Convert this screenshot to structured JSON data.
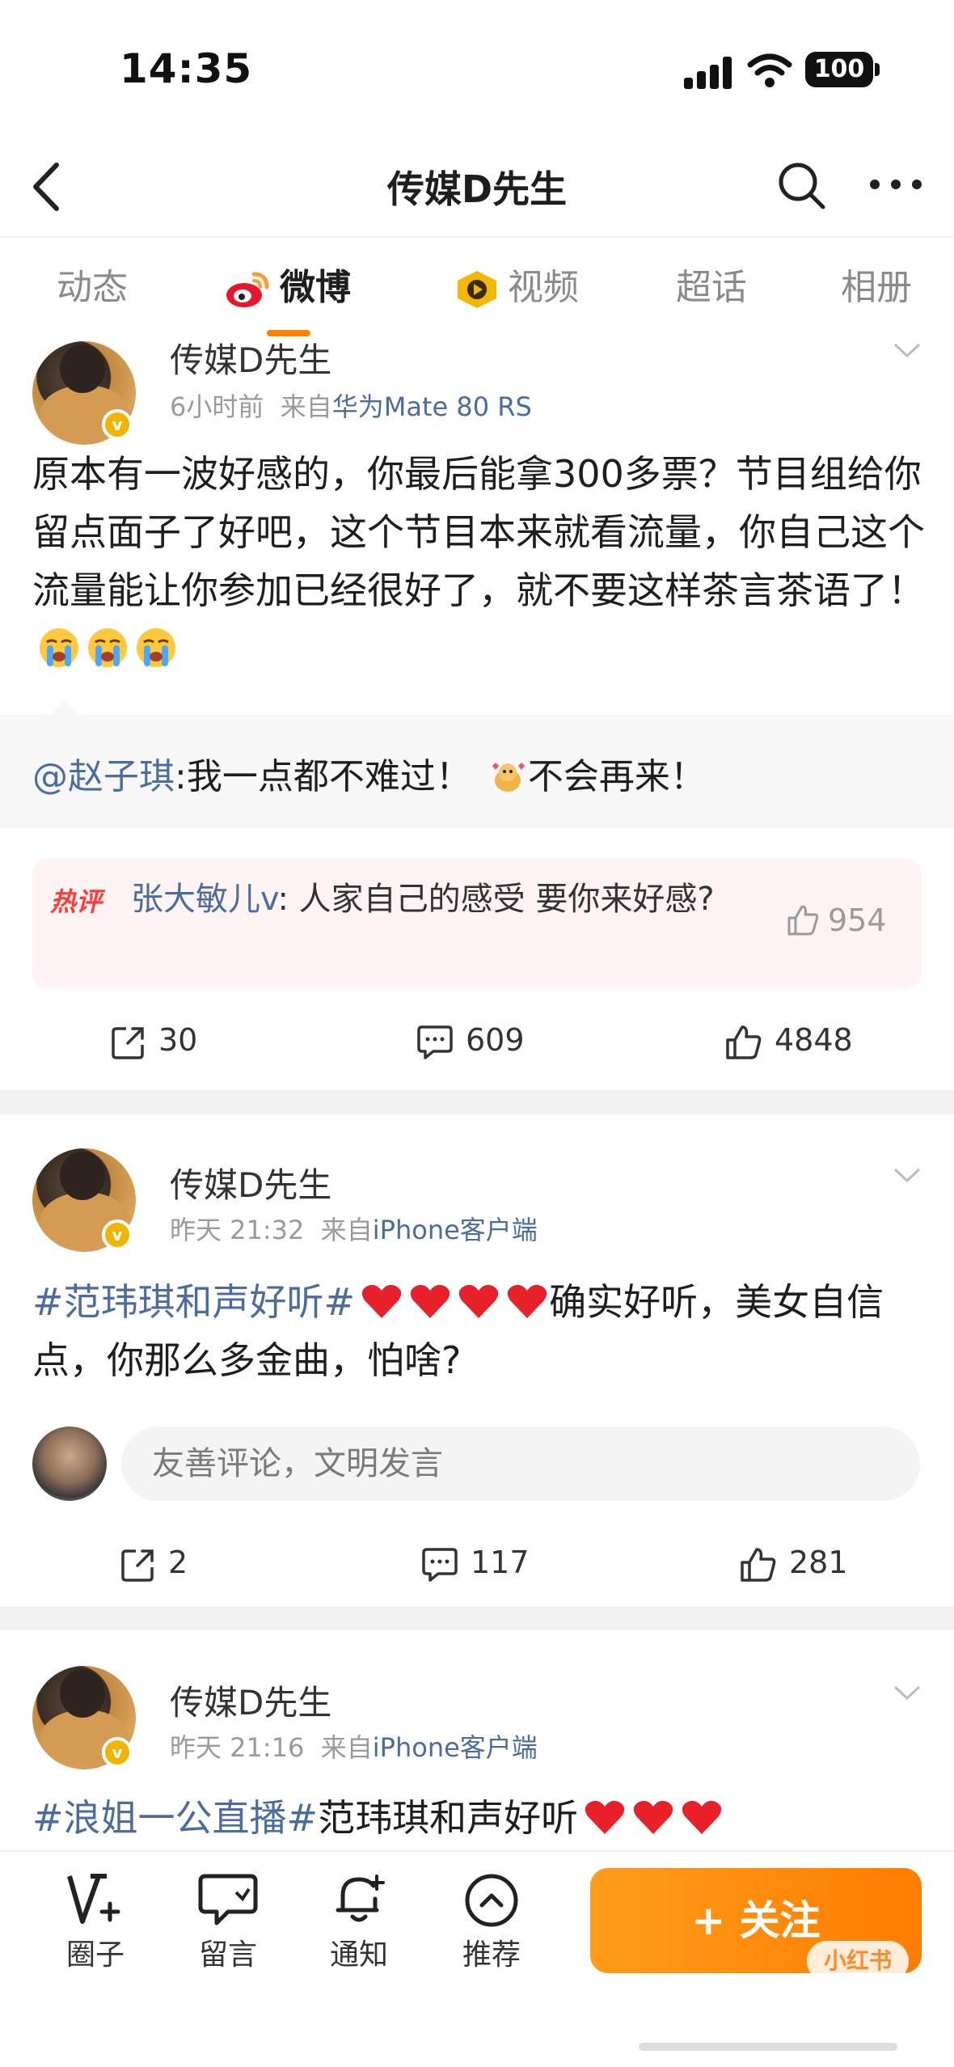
{
  "status": {
    "time": "14:35",
    "battery": "100"
  },
  "header": {
    "title": "传媒D先生"
  },
  "tabs": [
    {
      "label": "动态",
      "active": false
    },
    {
      "label": "微博",
      "active": true
    },
    {
      "label": "视频",
      "active": false
    },
    {
      "label": "超话",
      "active": false
    },
    {
      "label": "相册",
      "active": false
    }
  ],
  "posts": [
    {
      "author": "传媒D先生",
      "time": "6小时前",
      "source_prefix": "来自",
      "source": "华为Mate 80 RS",
      "text": "原本有一波好感的，你最后能拿300多票？节目组给你留点面子了好吧，这个节目本来就看流量，你自己这个流量能让你参加已经很好了，就不要这样茶言茶语了！",
      "emojis": [
        "crying-face",
        "crying-face",
        "crying-face"
      ],
      "quote": {
        "at": "@赵子琪",
        "text1": ":我一点都不难过！",
        "text2": "不会再来！"
      },
      "hot_comment": {
        "tag": "热评",
        "user": "张大敏儿v",
        "text": ": 人家自己的感受 要你来好感?",
        "likes": "954"
      },
      "stats": {
        "reposts": "30",
        "comments": "609",
        "likes": "4848"
      }
    },
    {
      "author": "传媒D先生",
      "time": "昨天 21:32",
      "source_prefix": "来自",
      "source": "iPhone客户端",
      "topic": "#范玮琪和声好听#",
      "text": "确实好听，美女自信点，你那么多金曲，怕啥?",
      "comment_placeholder": "友善评论，文明发言",
      "stats": {
        "reposts": "2",
        "comments": "117",
        "likes": "281"
      }
    },
    {
      "author": "传媒D先生",
      "time": "昨天 21:16",
      "source_prefix": "来自",
      "source": "iPhone客户端",
      "topic": "#浪姐一公直播#",
      "text": "范玮琪和声好听"
    }
  ],
  "bottom": {
    "items": [
      {
        "label": "圈子",
        "icon": "circle-v-icon"
      },
      {
        "label": "留言",
        "icon": "message-icon"
      },
      {
        "label": "通知",
        "icon": "bell-plus-icon"
      },
      {
        "label": "推荐",
        "icon": "chevron-up-circle-icon"
      }
    ],
    "follow": "+ 关注",
    "watermark": "小红书"
  },
  "colors": {
    "accent": "#ff8200",
    "link": "#4b6d9d",
    "heart": "#e8202a"
  }
}
